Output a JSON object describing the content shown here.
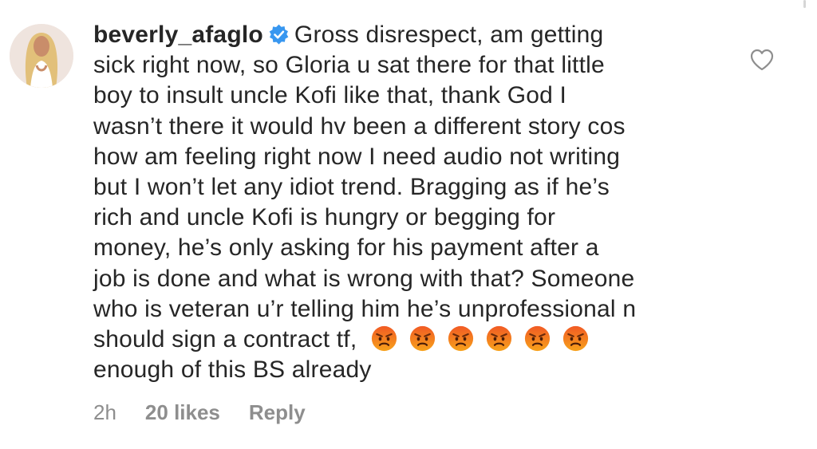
{
  "comment": {
    "username": "beverly_afaglo",
    "verified": true,
    "lines": [
      "Gross disrespect, am getting",
      "sick right now, so Gloria u sat there for that little",
      "boy to insult uncle Kofi like that, thank God I",
      "wasn’t there it would hv been a different story cos",
      "how am feeling right now I need audio not writing",
      "but I won’t let any idiot trend. Bragging as if he’s",
      "rich and uncle Kofi is hungry or begging for",
      "money, he’s only asking for his payment after a",
      "job is done and what is wrong with that? Someone",
      "who is veteran u’r telling him he’s unprofessional n",
      "should sign a contract tf,",
      "enough of this BS already"
    ],
    "emoji_name": "pouting-face-emoji",
    "emoji_count": 6,
    "time": "2h",
    "likes": "20 likes",
    "reply_label": "Reply"
  },
  "icons": {
    "verified": "verified-badge-icon",
    "like": "heart-outline-icon"
  },
  "colors": {
    "text": "#262626",
    "meta": "#8e8e8e",
    "verified": "#3897f0",
    "emoji_top": "#f15a24",
    "emoji_bottom": "#f7a21b"
  }
}
